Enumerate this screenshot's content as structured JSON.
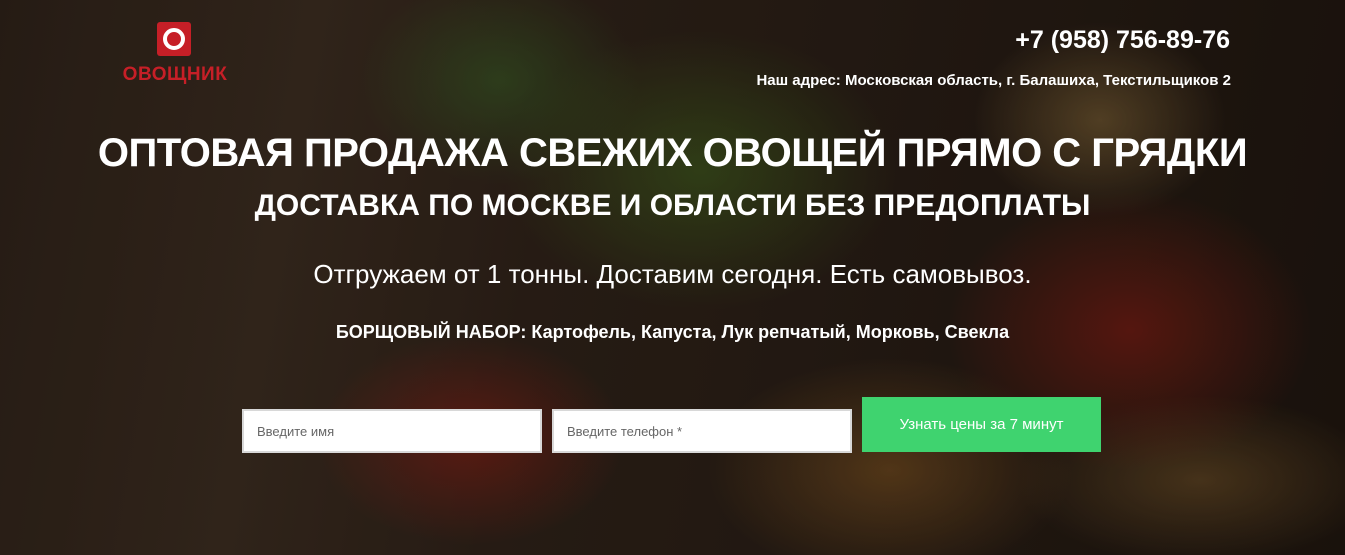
{
  "header": {
    "logo_text": "ОВОЩНИК",
    "phone": "+7 (958) 756-89-76",
    "address": "Наш адрес: Московская область, г. Балашиха, Текстильщиков 2"
  },
  "hero": {
    "title": "ОПТОВАЯ ПРОДАЖА СВЕЖИХ ОВОЩЕЙ ПРЯМО С ГРЯДКИ",
    "subtitle": "ДОСТАВКА ПО МОСКВЕ И ОБЛАСТИ БЕЗ ПРЕДОПЛАТЫ",
    "offer": "Отгружаем от 1 тонны. Доставим сегодня. Есть самовывоз.",
    "set_label": "БОРЩОВЫЙ НАБОР:",
    "set_items": "Картофель, Капуста, Лук репчатый, Морковь, Свекла"
  },
  "form": {
    "name_placeholder": "Введите имя",
    "phone_placeholder": "Введите телефон *",
    "submit_label": "Узнать цены за 7 минут"
  },
  "colors": {
    "brand_red": "#c61f27",
    "button_green": "#3fd36f"
  }
}
